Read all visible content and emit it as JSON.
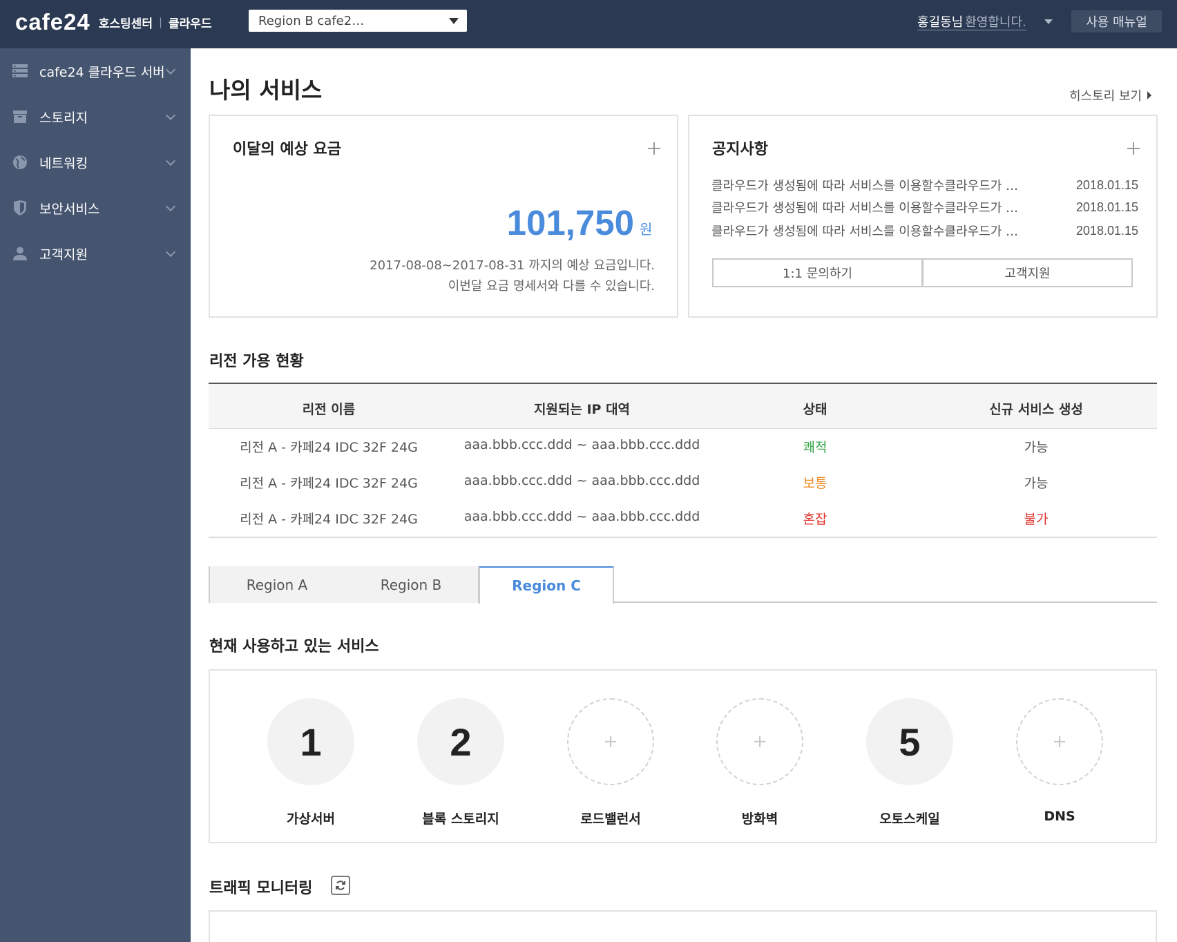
{
  "header": {
    "logo": "cafe24",
    "logo_sub": "호스팅센터",
    "logo_sep": "|",
    "logo_sub2": "클라우드",
    "region_select": "Region B cafe2…",
    "user_name": "홍길동님",
    "user_welcome": "환영합니다.",
    "manual": "사용 매뉴얼"
  },
  "sidebar": {
    "items": [
      {
        "label": "cafe24 클라우드 서버",
        "icon": "server-icon"
      },
      {
        "label": "스토리지",
        "icon": "storage-box-icon"
      },
      {
        "label": "네트워킹",
        "icon": "globe-icon"
      },
      {
        "label": "보안서비스",
        "icon": "shield-icon"
      },
      {
        "label": "고객지원",
        "icon": "user-icon"
      }
    ]
  },
  "main": {
    "title": "나의 서비스",
    "history_link": "히스토리 보기",
    "fee_card": {
      "title": "이달의 예상 요금",
      "amount": "101,750",
      "unit": "원",
      "desc1": "2017-08-08~2017-08-31 까지의 예상 요금입니다.",
      "desc2": "이번달 요금 명세서와 다를 수 있습니다."
    },
    "notice_card": {
      "title": "공지사항",
      "items": [
        {
          "text": "클라우드가 생성됨에 따라 서비스를 이용할수클라우드가 …",
          "date": "2018.01.15"
        },
        {
          "text": "클라우드가 생성됨에 따라 서비스를 이용할수클라우드가 …",
          "date": "2018.01.15"
        },
        {
          "text": "클라우드가 생성됨에 따라 서비스를 이용할수클라우드가 …",
          "date": "2018.01.15"
        }
      ],
      "btn_inquiry": "1:1 문의하기",
      "btn_support": "고객지원"
    },
    "region_status": {
      "title": "리전 가용 현황",
      "headers": [
        "리전 이름",
        "지원되는 IP 대역",
        "상태",
        "신규 서비스 생성"
      ],
      "rows": [
        {
          "name": "리전 A - 카페24 IDC 32F 24G",
          "ip": "aaa.bbb.ccc.ddd ~ aaa.bbb.ccc.ddd",
          "status": "쾌적",
          "status_color": "#3aa44a",
          "create": "가능",
          "create_color": "#555555"
        },
        {
          "name": "리전 A - 카페24 IDC 32F 24G",
          "ip": "aaa.bbb.ccc.ddd ~ aaa.bbb.ccc.ddd",
          "status": "보통",
          "status_color": "#ef8a24",
          "create": "가능",
          "create_color": "#555555"
        },
        {
          "name": "리전 A - 카페24 IDC 32F 24G",
          "ip": "aaa.bbb.ccc.ddd ~ aaa.bbb.ccc.ddd",
          "status": "혼잡",
          "status_color": "#e0332c",
          "create": "불가",
          "create_color": "#e0332c"
        }
      ]
    },
    "tabs": [
      {
        "label": "Region A",
        "active": false
      },
      {
        "label": "Region B",
        "active": false
      },
      {
        "label": "Region C",
        "active": true
      }
    ],
    "services": {
      "title": "현재 사용하고 있는 서비스",
      "items": [
        {
          "label": "가상서버",
          "count": "1"
        },
        {
          "label": "블록 스토리지",
          "count": "2"
        },
        {
          "label": "로드밸런서",
          "count": "+"
        },
        {
          "label": "방화벽",
          "count": "+"
        },
        {
          "label": "오토스케일",
          "count": "5"
        },
        {
          "label": "DNS",
          "count": "+"
        }
      ]
    },
    "traffic": {
      "title": "트래픽 모니터링"
    }
  },
  "colors": {
    "header_bg": "#2b3a52",
    "sidebar_bg": "#45546f",
    "accent": "#4a8bdc"
  }
}
